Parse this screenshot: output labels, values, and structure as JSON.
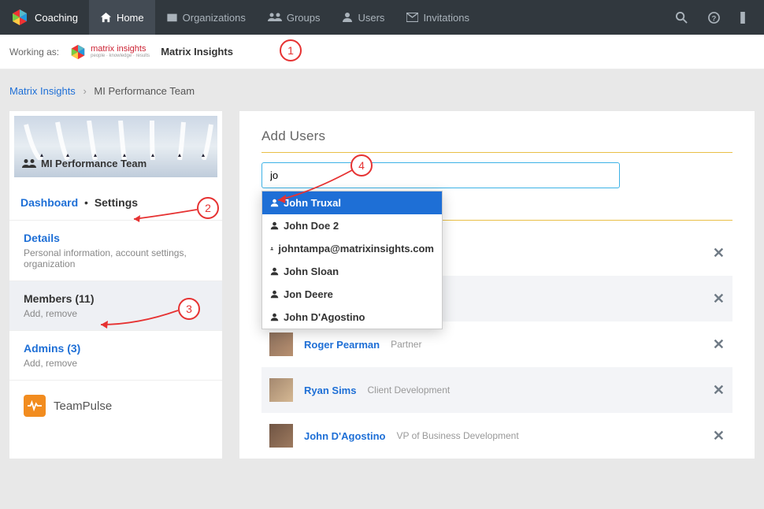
{
  "brand": "Coaching",
  "nav": {
    "home": "Home",
    "orgs": "Organizations",
    "groups": "Groups",
    "users": "Users",
    "invitations": "Invitations"
  },
  "working_as": {
    "label": "Working as:",
    "logo_text_top": "matrix insights",
    "logo_text_sub": "people · knowledge · results",
    "active": "Matrix Insights"
  },
  "breadcrumb": {
    "root": "Matrix Insights",
    "current": "MI Performance Team"
  },
  "sidebar": {
    "team_name": "MI Performance Team",
    "tabs": {
      "dashboard": "Dashboard",
      "settings": "Settings"
    },
    "details": {
      "title": "Details",
      "sub": "Personal information, account settings, organization"
    },
    "members": {
      "title": "Members (11)",
      "sub": "Add, remove"
    },
    "admins": {
      "title": "Admins (3)",
      "sub": "Add, remove"
    },
    "teampulse": "TeamPulse"
  },
  "main": {
    "heading": "Add Users",
    "search_value": "jo",
    "dropdown": [
      "John Truxal",
      "John Doe 2",
      "johntampa@matrixinsights.com",
      "John Sloan",
      "Jon Deere",
      "John D'Agostino"
    ],
    "rows": [
      {
        "name": "",
        "role": ""
      },
      {
        "name": "",
        "role": ""
      },
      {
        "name": "Roger Pearman",
        "role": "Partner"
      },
      {
        "name": "Ryan Sims",
        "role": "Client Development"
      },
      {
        "name": "John D'Agostino",
        "role": "VP of Business Development"
      }
    ]
  },
  "annotations": {
    "n1": "1",
    "n2": "2",
    "n3": "3",
    "n4": "4"
  }
}
